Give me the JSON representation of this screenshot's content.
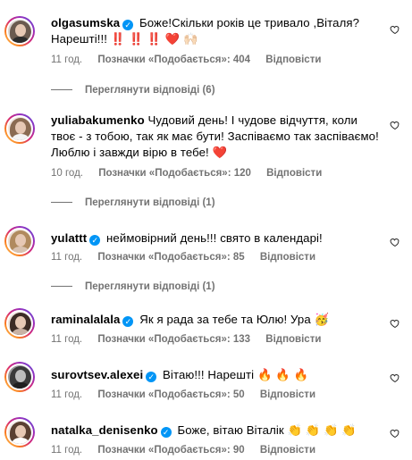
{
  "comments": [
    {
      "username": "olgasumska",
      "verified": true,
      "text": "Боже!Скільки років це тривало ,Віталя? Нарешті!!! ‼️ ‼️ ‼️ ❤️ 🙌🏻",
      "time": "11 год.",
      "likes": "Позначки «Подобається»: 404",
      "reply": "Відповісти",
      "view_replies": "Переглянути відповіді (6)"
    },
    {
      "username": "yuliabakumenko",
      "verified": false,
      "text": "Чудовий день! І чудове відчуття, коли твоє - з тобою, так як має бути! Заспіваємо так заспіваємо! Люблю і завжди вірю в тебе! ❤️",
      "time": "10 год.",
      "likes": "Позначки «Подобається»: 120",
      "reply": "Відповісти",
      "view_replies": "Переглянути відповіді (1)"
    },
    {
      "username": "yulattt",
      "verified": true,
      "text": "неймовірний день!!! свято в календарі!",
      "time": "11 год.",
      "likes": "Позначки «Подобається»: 85",
      "reply": "Відповісти",
      "view_replies": "Переглянути відповіді (1)"
    },
    {
      "username": "raminalalala",
      "verified": true,
      "text": "Як я рада за тебе та Юлю! Ура 🥳",
      "time": "11 год.",
      "likes": "Позначки «Подобається»: 133",
      "reply": "Відповісти"
    },
    {
      "username": "surovtsev.alexei",
      "verified": true,
      "text": "Вітаю!!! Нарешті 🔥 🔥 🔥",
      "time": "11 год.",
      "likes": "Позначки «Подобається»: 50",
      "reply": "Відповісти"
    },
    {
      "username": "natalka_denisenko",
      "verified": true,
      "text": "Боже, вітаю Віталік 👏 👏 👏 👏",
      "time": "11 год.",
      "likes": "Позначки «Подобається»: 90",
      "reply": "Відповісти"
    }
  ],
  "icons": {
    "like": "heart-outline-icon",
    "verified": "verified-badge-icon"
  },
  "colors": {
    "accent": "#0095f6",
    "secondary_text": "#737373"
  }
}
